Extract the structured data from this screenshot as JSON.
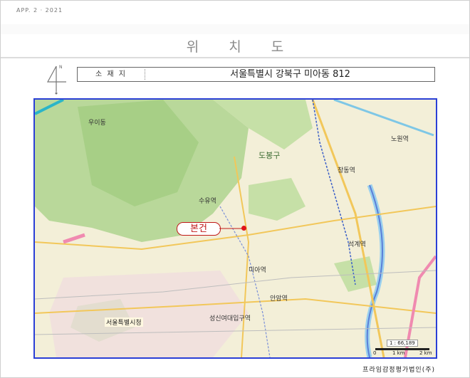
{
  "page": {
    "page_id": "APP. 2 · 2021",
    "title": "위 치 도",
    "firm_name": "프라임감정평가법인(주)"
  },
  "location": {
    "label": "소 재 지",
    "address": "서울특별시 강북구 미아동 812"
  },
  "compass": {
    "north_label": "N"
  },
  "map": {
    "district_label": "도봉구",
    "city_hall_label": "서울특별시청",
    "subject_label": "본건",
    "scale_ratio": "1 : 66,189",
    "scale_ticks": [
      "0",
      "1 km",
      "2 km"
    ],
    "place_labels": [
      "우이동",
      "수유역",
      "미아역",
      "성신여대입구역",
      "창동역",
      "노원역",
      "석계역",
      "안암역"
    ],
    "colors": {
      "frame": "#2a3fd6",
      "mountain": "#b9d89a",
      "urban": "#f3efd8",
      "river": "#7ec7e6",
      "road": "#f2c75a",
      "subject": "#e0141b"
    }
  }
}
